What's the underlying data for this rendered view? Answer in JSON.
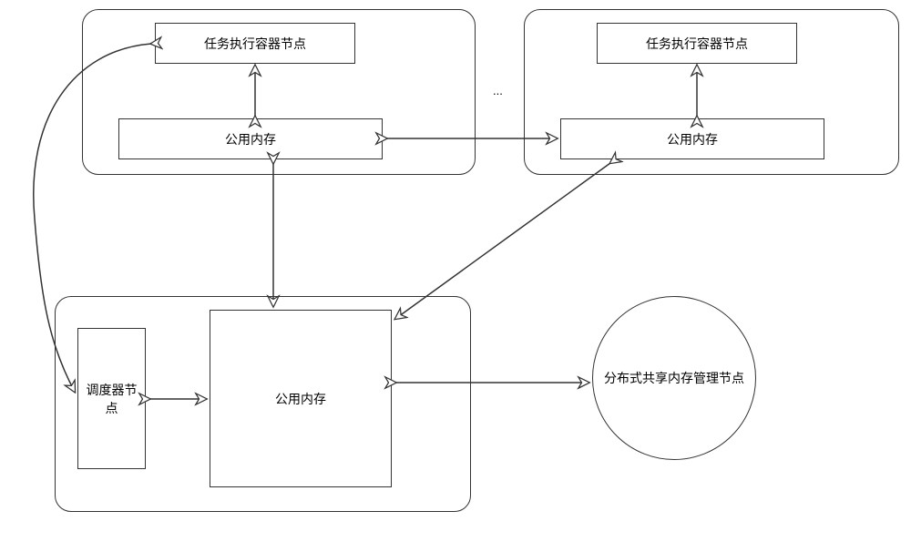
{
  "labels": {
    "task_exec_node_left": "任务执行容器节点",
    "task_exec_node_right": "任务执行容器节点",
    "shared_mem_top_left": "公用内存",
    "shared_mem_top_right": "公用内存",
    "shared_mem_bottom": "公用内存",
    "scheduler_node": "调度器节点",
    "dsm_mgmt_node": "分布式共享内存管理节点",
    "ellipsis": "..."
  }
}
